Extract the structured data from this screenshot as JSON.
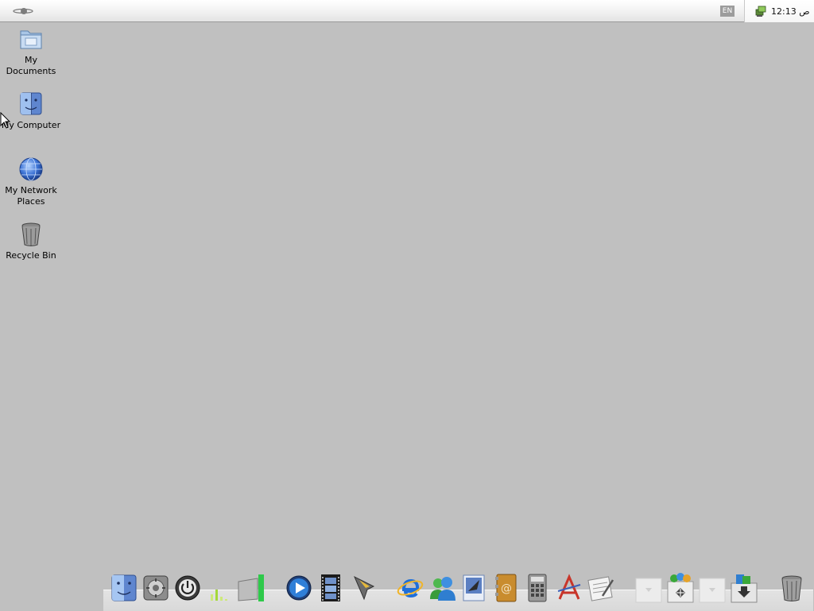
{
  "menubar": {
    "language": "EN",
    "clock": "12:13 ص"
  },
  "desktop": {
    "icons": [
      {
        "label": "My Documents",
        "icon": "folder-icon"
      },
      {
        "label": "My Computer",
        "icon": "finder-face-icon"
      },
      {
        "label": "My Network Places",
        "icon": "globe-icon"
      },
      {
        "label": "Recycle Bin",
        "icon": "trash-icon"
      }
    ]
  },
  "dock": {
    "items": [
      "finder-icon",
      "system-preferences-icon",
      "shutdown-icon",
      "bar-graph-icon",
      "drive-icon",
      "media-player-icon",
      "film-icon",
      "launcher-icon",
      "internet-explorer-icon",
      "messenger-icon",
      "mail-icon",
      "address-book-icon",
      "calculator-icon",
      "text-editor-icon",
      "script-editor-icon",
      "empty-slot-icon",
      "control-panel-icon",
      "empty-slot-icon",
      "downloads-icon",
      "trash-icon"
    ]
  },
  "colors": {
    "desktop": "#c0c0c0",
    "menubar": "#f1f1f1",
    "dock_shelf": "#e5e5e5"
  }
}
